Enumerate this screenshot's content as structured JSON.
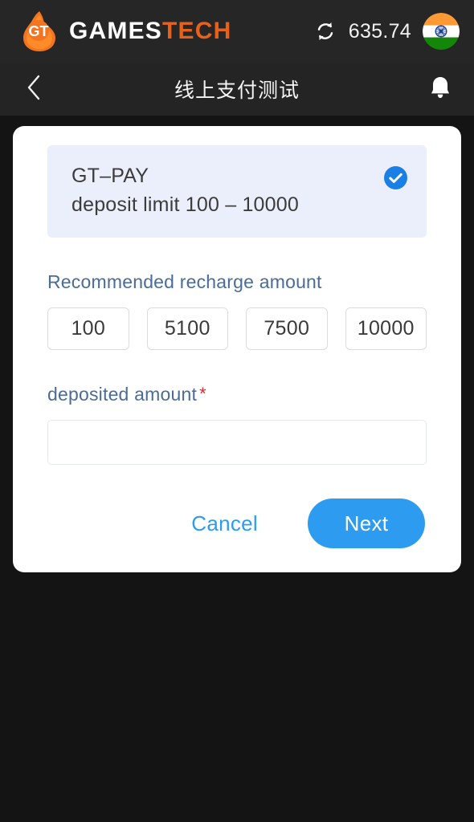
{
  "brandbar": {
    "logo_icon": "gt-flame-logo-icon",
    "wordmark_primary": "GAMES",
    "wordmark_accent": "TECH",
    "refresh_icon": "refresh-icon",
    "balance": "635.74",
    "flag_icon": "india-flag-icon",
    "accent_color": "#e8611a",
    "bar_color": "#262626"
  },
  "navbar": {
    "back_icon": "chevron-left-icon",
    "title": "线上支付测试",
    "bell_icon": "bell-icon",
    "bar_color": "#242424"
  },
  "payment_method": {
    "name": "GT–PAY",
    "limit_text": "deposit limit 100 – 10000",
    "selected": true,
    "check_icon": "check-circle-icon",
    "card_color": "#ebeffb",
    "check_color": "#1a80e5"
  },
  "recommended": {
    "label": "Recommended recharge amount",
    "options": [
      "100",
      "5100",
      "7500",
      "10000"
    ]
  },
  "deposit": {
    "label": "deposited amount",
    "required_marker": "*",
    "value": "",
    "placeholder": ""
  },
  "actions": {
    "cancel_label": "Cancel",
    "next_label": "Next",
    "primary_color": "#2d9cf0"
  }
}
